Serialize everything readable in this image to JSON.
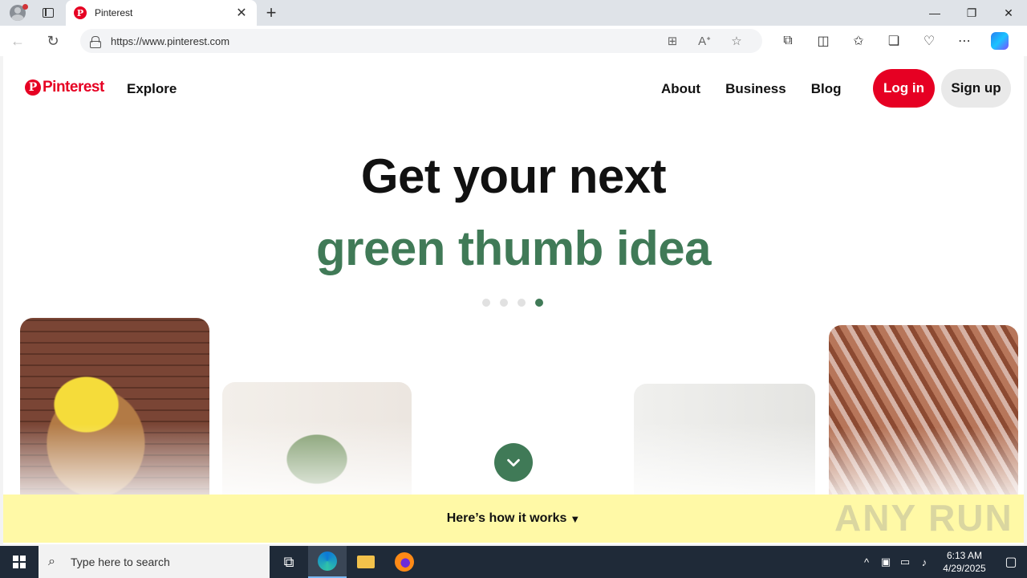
{
  "browser": {
    "tab_title": "Pinterest",
    "tab_close": "✕",
    "new_tab": "+",
    "url": "https://www.pinterest.com",
    "window_minimize": "—",
    "window_restore": "❐",
    "window_close": "✕"
  },
  "header": {
    "logo_text": "Pinterest",
    "explore": "Explore",
    "links": [
      "About",
      "Business",
      "Blog"
    ],
    "login": "Log in",
    "signup": "Sign up"
  },
  "hero": {
    "line1": "Get your next",
    "line2": "green thumb idea",
    "active_dot_index": 3,
    "dot_count": 4
  },
  "footer_bar": {
    "label": "Here’s how it works"
  },
  "watermark": "ANY RUN",
  "taskbar": {
    "search_placeholder": "Type here to search",
    "time": "6:13 AM",
    "date": "4/29/2025"
  },
  "colors": {
    "brand_red": "#e60023",
    "accent_green": "#407a57",
    "howbar_yellow": "#fff9a6"
  }
}
